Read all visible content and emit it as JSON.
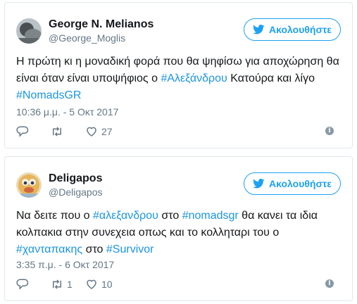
{
  "tweets": [
    {
      "name": "George N. Melianos",
      "handle": "@George_Moglis",
      "follow_label": "Ακολουθήστε",
      "text": [
        {
          "t": "Η πρώτη κι η μοναδική φορά που θα ψηφίσω για αποχώρηση θα είναι όταν είναι υποψήφιος ο ",
          "tag": false
        },
        {
          "t": "#Αλεξάνδρου",
          "tag": true
        },
        {
          "t": " Κατούρα και λίγο ",
          "tag": false
        },
        {
          "t": "#NomadsGR",
          "tag": true
        }
      ],
      "timestamp": "10:36 μ.μ. - 5 Οκτ 2017",
      "reply_count": "",
      "retweet_count": "",
      "like_count": "27",
      "info_label": "i"
    },
    {
      "name": "Deligapos",
      "handle": "@Deligapos",
      "follow_label": "Ακολουθήστε",
      "text": [
        {
          "t": "Να δειτε που ο ",
          "tag": false
        },
        {
          "t": "#αλεξανδρου",
          "tag": true
        },
        {
          "t": " στο ",
          "tag": false
        },
        {
          "t": "#nomadsgr",
          "tag": true
        },
        {
          "t": " θα κανει τα ιδια κολπακια στην συνεχεια οπως και το κολληταρι του ο ",
          "tag": false
        },
        {
          "t": "#χανταπακης",
          "tag": true
        },
        {
          "t": " στο ",
          "tag": false
        },
        {
          "t": "#Survivor",
          "tag": true
        }
      ],
      "timestamp": "3:35 π.μ. - 6 Οκτ 2017",
      "reply_count": "",
      "retweet_count": "1",
      "like_count": "10",
      "info_label": "i"
    }
  ],
  "colors": {
    "accent": "#1da1f2",
    "hashtag": "#1b95e0",
    "muted": "#657786",
    "border": "#e1e8ed"
  },
  "icons": [
    "bird-icon",
    "reply-icon",
    "retweet-icon",
    "heart-icon",
    "info-icon"
  ]
}
